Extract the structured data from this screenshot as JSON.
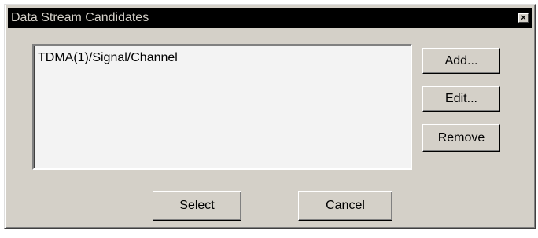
{
  "window": {
    "title": "Data Stream Candidates",
    "close_glyph": "×"
  },
  "candidates": {
    "items": [
      "TDMA(1)/Signal/Channel"
    ]
  },
  "buttons": {
    "add": "Add...",
    "edit": "Edit...",
    "remove": "Remove",
    "select": "Select",
    "cancel": "Cancel"
  },
  "colors": {
    "face": "#d4d0c8",
    "titlebar": "#000000",
    "title_text": "#d4d0c8",
    "list_background": "#f3f3f3"
  },
  "icons": {
    "close": "close-icon"
  }
}
